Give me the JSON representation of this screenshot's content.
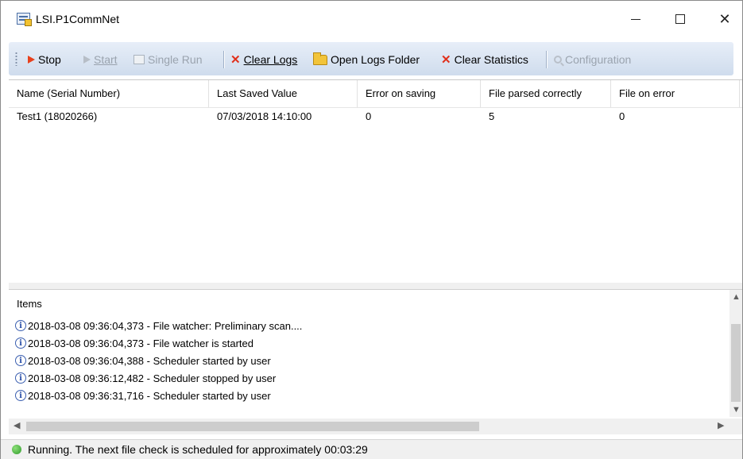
{
  "window": {
    "title": "LSI.P1CommNet"
  },
  "toolbar": {
    "stop": "Stop",
    "start": "Start",
    "single_run": "Single Run",
    "clear_logs": "Clear Logs",
    "open_logs_folder": "Open Logs Folder",
    "clear_statistics": "Clear Statistics",
    "configuration": "Configuration"
  },
  "grid": {
    "columns": [
      "Name (Serial Number)",
      "Last Saved Value",
      "Error on saving",
      "File parsed correctly",
      "File on error"
    ],
    "rows": [
      [
        "Test1 (18020266)",
        "07/03/2018 14:10:00",
        "0",
        "5",
        "0"
      ]
    ]
  },
  "log": {
    "title": "Items",
    "entries": [
      "2018-03-08 09:36:04,373 - File watcher: Preliminary scan....",
      "2018-03-08 09:36:04,373 - File watcher is started",
      "2018-03-08 09:36:04,388 - Scheduler started by user",
      "2018-03-08 09:36:12,482 - Scheduler stopped by user",
      "2018-03-08 09:36:31,716 - Scheduler started by user"
    ]
  },
  "status": {
    "text": "Running. The next file check is scheduled for approximately 00:03:29",
    "indicator_color": "#2e9a2a"
  },
  "icons": {
    "stop": "play-icon",
    "start": "play-icon",
    "single_run": "run-icon",
    "clear_logs": "x-icon",
    "open_logs_folder": "folder-icon",
    "clear_statistics": "x-icon",
    "configuration": "settings-icon",
    "log_entry": "info-icon"
  }
}
